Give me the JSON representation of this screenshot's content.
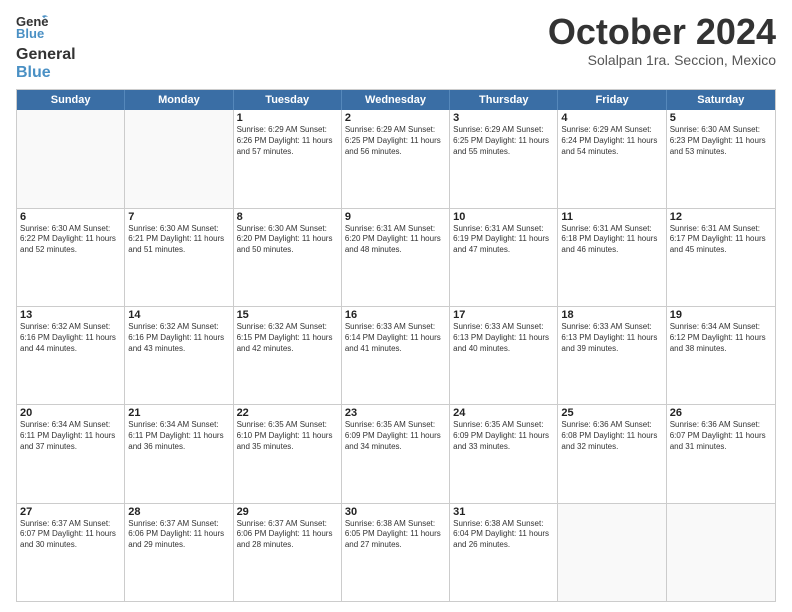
{
  "header": {
    "logo_line1": "General",
    "logo_line2": "Blue",
    "month": "October 2024",
    "location": "Solalpan 1ra. Seccion, Mexico"
  },
  "weekdays": [
    "Sunday",
    "Monday",
    "Tuesday",
    "Wednesday",
    "Thursday",
    "Friday",
    "Saturday"
  ],
  "weeks": [
    [
      {
        "day": "",
        "info": ""
      },
      {
        "day": "",
        "info": ""
      },
      {
        "day": "1",
        "info": "Sunrise: 6:29 AM\nSunset: 6:26 PM\nDaylight: 11 hours and 57 minutes."
      },
      {
        "day": "2",
        "info": "Sunrise: 6:29 AM\nSunset: 6:25 PM\nDaylight: 11 hours and 56 minutes."
      },
      {
        "day": "3",
        "info": "Sunrise: 6:29 AM\nSunset: 6:25 PM\nDaylight: 11 hours and 55 minutes."
      },
      {
        "day": "4",
        "info": "Sunrise: 6:29 AM\nSunset: 6:24 PM\nDaylight: 11 hours and 54 minutes."
      },
      {
        "day": "5",
        "info": "Sunrise: 6:30 AM\nSunset: 6:23 PM\nDaylight: 11 hours and 53 minutes."
      }
    ],
    [
      {
        "day": "6",
        "info": "Sunrise: 6:30 AM\nSunset: 6:22 PM\nDaylight: 11 hours and 52 minutes."
      },
      {
        "day": "7",
        "info": "Sunrise: 6:30 AM\nSunset: 6:21 PM\nDaylight: 11 hours and 51 minutes."
      },
      {
        "day": "8",
        "info": "Sunrise: 6:30 AM\nSunset: 6:20 PM\nDaylight: 11 hours and 50 minutes."
      },
      {
        "day": "9",
        "info": "Sunrise: 6:31 AM\nSunset: 6:20 PM\nDaylight: 11 hours and 48 minutes."
      },
      {
        "day": "10",
        "info": "Sunrise: 6:31 AM\nSunset: 6:19 PM\nDaylight: 11 hours and 47 minutes."
      },
      {
        "day": "11",
        "info": "Sunrise: 6:31 AM\nSunset: 6:18 PM\nDaylight: 11 hours and 46 minutes."
      },
      {
        "day": "12",
        "info": "Sunrise: 6:31 AM\nSunset: 6:17 PM\nDaylight: 11 hours and 45 minutes."
      }
    ],
    [
      {
        "day": "13",
        "info": "Sunrise: 6:32 AM\nSunset: 6:16 PM\nDaylight: 11 hours and 44 minutes."
      },
      {
        "day": "14",
        "info": "Sunrise: 6:32 AM\nSunset: 6:16 PM\nDaylight: 11 hours and 43 minutes."
      },
      {
        "day": "15",
        "info": "Sunrise: 6:32 AM\nSunset: 6:15 PM\nDaylight: 11 hours and 42 minutes."
      },
      {
        "day": "16",
        "info": "Sunrise: 6:33 AM\nSunset: 6:14 PM\nDaylight: 11 hours and 41 minutes."
      },
      {
        "day": "17",
        "info": "Sunrise: 6:33 AM\nSunset: 6:13 PM\nDaylight: 11 hours and 40 minutes."
      },
      {
        "day": "18",
        "info": "Sunrise: 6:33 AM\nSunset: 6:13 PM\nDaylight: 11 hours and 39 minutes."
      },
      {
        "day": "19",
        "info": "Sunrise: 6:34 AM\nSunset: 6:12 PM\nDaylight: 11 hours and 38 minutes."
      }
    ],
    [
      {
        "day": "20",
        "info": "Sunrise: 6:34 AM\nSunset: 6:11 PM\nDaylight: 11 hours and 37 minutes."
      },
      {
        "day": "21",
        "info": "Sunrise: 6:34 AM\nSunset: 6:11 PM\nDaylight: 11 hours and 36 minutes."
      },
      {
        "day": "22",
        "info": "Sunrise: 6:35 AM\nSunset: 6:10 PM\nDaylight: 11 hours and 35 minutes."
      },
      {
        "day": "23",
        "info": "Sunrise: 6:35 AM\nSunset: 6:09 PM\nDaylight: 11 hours and 34 minutes."
      },
      {
        "day": "24",
        "info": "Sunrise: 6:35 AM\nSunset: 6:09 PM\nDaylight: 11 hours and 33 minutes."
      },
      {
        "day": "25",
        "info": "Sunrise: 6:36 AM\nSunset: 6:08 PM\nDaylight: 11 hours and 32 minutes."
      },
      {
        "day": "26",
        "info": "Sunrise: 6:36 AM\nSunset: 6:07 PM\nDaylight: 11 hours and 31 minutes."
      }
    ],
    [
      {
        "day": "27",
        "info": "Sunrise: 6:37 AM\nSunset: 6:07 PM\nDaylight: 11 hours and 30 minutes."
      },
      {
        "day": "28",
        "info": "Sunrise: 6:37 AM\nSunset: 6:06 PM\nDaylight: 11 hours and 29 minutes."
      },
      {
        "day": "29",
        "info": "Sunrise: 6:37 AM\nSunset: 6:06 PM\nDaylight: 11 hours and 28 minutes."
      },
      {
        "day": "30",
        "info": "Sunrise: 6:38 AM\nSunset: 6:05 PM\nDaylight: 11 hours and 27 minutes."
      },
      {
        "day": "31",
        "info": "Sunrise: 6:38 AM\nSunset: 6:04 PM\nDaylight: 11 hours and 26 minutes."
      },
      {
        "day": "",
        "info": ""
      },
      {
        "day": "",
        "info": ""
      }
    ]
  ]
}
